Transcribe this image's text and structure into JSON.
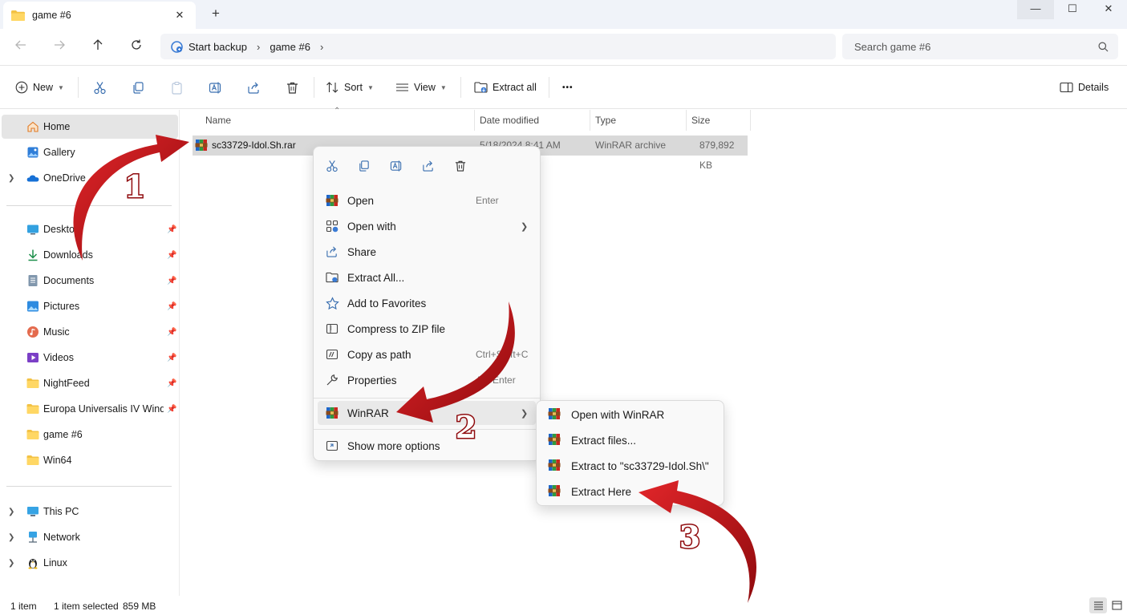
{
  "window": {
    "tab_title": "game #6",
    "tab_close": "✕",
    "new_tab": "+",
    "minimize": "—",
    "maximize": "☐",
    "close": "✕"
  },
  "address": {
    "crumbs": [
      "Start backup",
      "game #6"
    ],
    "search_placeholder": "Search game #6"
  },
  "commands": {
    "new_label": "New",
    "sort_label": "Sort",
    "view_label": "View",
    "extract_all_label": "Extract all",
    "more_label": "•••",
    "details_label": "Details"
  },
  "sidebar": {
    "top": [
      {
        "label": "Home",
        "icon": "home-icon",
        "selected": true
      },
      {
        "label": "Gallery",
        "icon": "gallery-icon"
      },
      {
        "label": "OneDrive",
        "icon": "onedrive-icon",
        "expandable": true
      }
    ],
    "quick": [
      {
        "label": "Desktop",
        "icon": "desktop-icon"
      },
      {
        "label": "Downloads",
        "icon": "downloads-icon"
      },
      {
        "label": "Documents",
        "icon": "documents-icon"
      },
      {
        "label": "Pictures",
        "icon": "pictures-icon"
      },
      {
        "label": "Music",
        "icon": "music-icon"
      },
      {
        "label": "Videos",
        "icon": "videos-icon"
      },
      {
        "label": "NightFeed",
        "icon": "folder-icon"
      },
      {
        "label": "Europa Universalis IV Winds of Change",
        "icon": "folder-icon"
      },
      {
        "label": "game #6",
        "icon": "folder-icon"
      },
      {
        "label": "Win64",
        "icon": "folder-icon"
      }
    ],
    "bottom": [
      {
        "label": "This PC",
        "icon": "this-pc-icon"
      },
      {
        "label": "Network",
        "icon": "network-icon"
      },
      {
        "label": "Linux",
        "icon": "linux-icon"
      }
    ]
  },
  "filelist": {
    "columns": [
      "Name",
      "Date modified",
      "Type",
      "Size"
    ],
    "rows": [
      {
        "name": "sc33729-Idol.Sh.rar",
        "date": "5/18/2024 8:41 AM",
        "type": "WinRAR archive",
        "size": "879,892 KB"
      }
    ]
  },
  "context_menu": {
    "items": [
      {
        "label": "Open",
        "shortcut": "Enter",
        "icon": "winrar-icon"
      },
      {
        "label": "Open with",
        "shortcut": "",
        "icon": "open-with-icon",
        "submenu": true
      },
      {
        "label": "Share",
        "shortcut": "",
        "icon": "share-icon"
      },
      {
        "label": "Extract All...",
        "shortcut": "",
        "icon": "extract-all-icon"
      },
      {
        "label": "Add to Favorites",
        "shortcut": "",
        "icon": "star-icon"
      },
      {
        "label": "Compress to ZIP file",
        "shortcut": "",
        "icon": "zip-icon"
      },
      {
        "label": "Copy as path",
        "shortcut": "Ctrl+Shift+C",
        "icon": "copy-path-icon"
      },
      {
        "label": "Properties",
        "shortcut": "Alt+Enter",
        "icon": "properties-icon"
      }
    ],
    "winrar_label": "WinRAR",
    "more_options_label": "Show more options"
  },
  "winrar_submenu": {
    "items": [
      "Open with WinRAR",
      "Extract files...",
      "Extract to \"sc33729-Idol.Sh\\\"",
      "Extract Here"
    ]
  },
  "status": {
    "count": "1 item",
    "selection": "1 item selected",
    "size": "859 MB"
  },
  "annotations": {
    "step1": "1",
    "step2": "2",
    "step3": "3",
    "arrow_color": "#c40f14"
  }
}
